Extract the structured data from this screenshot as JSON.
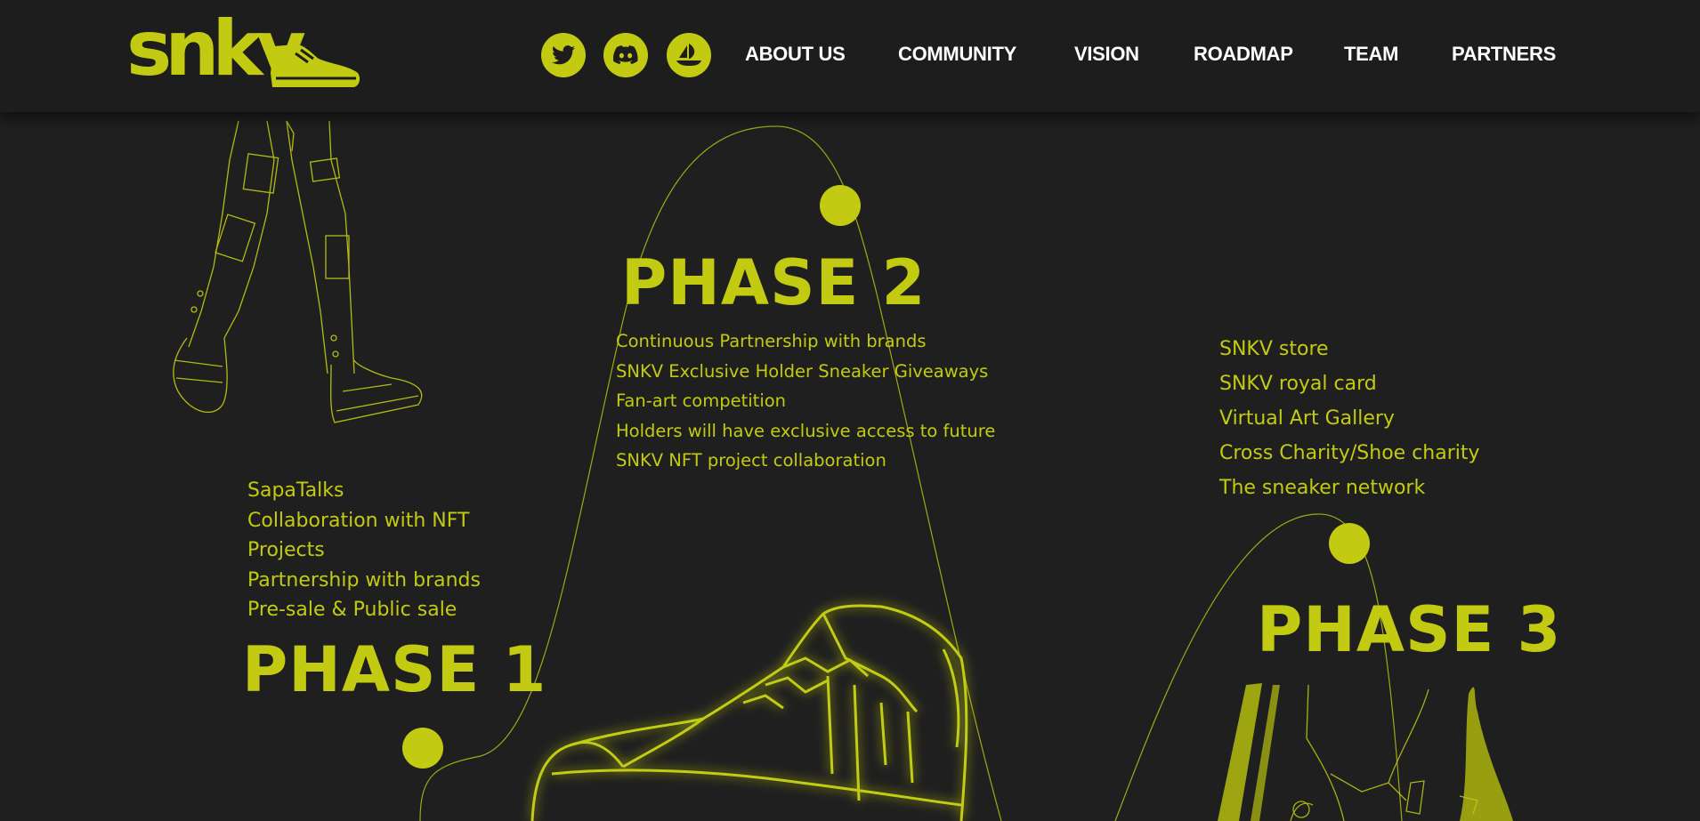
{
  "header": {
    "logo_text": "snkv",
    "social": [
      {
        "name": "twitter-icon"
      },
      {
        "name": "discord-icon"
      },
      {
        "name": "opensea-icon"
      }
    ],
    "nav": [
      {
        "label": "ABOUT US"
      },
      {
        "label": "COMMUNITY"
      },
      {
        "label": "VISION"
      },
      {
        "label": "ROADMAP"
      },
      {
        "label": "TEAM"
      },
      {
        "label": "PARTNERS"
      }
    ]
  },
  "roadmap": {
    "phase1": {
      "title": "PHASE 1",
      "items": [
        "SapaTalks",
        "Collaboration with NFT",
        "Projects",
        "Partnership with brands",
        "Pre-sale & Public sale"
      ]
    },
    "phase2": {
      "title": "PHASE 2",
      "items": [
        "Continuous Partnership with brands",
        "SNKV Exclusive Holder Sneaker Giveaways",
        "Fan-art competition",
        "Holders will have exclusive access to future",
        "SNKV NFT project collaboration"
      ]
    },
    "phase3": {
      "title": "PHASE 3",
      "items": [
        "SNKV store",
        "SNKV royal card",
        "Virtual Art Gallery",
        "Cross Charity/Shoe charity",
        "The sneaker network"
      ]
    }
  },
  "colors": {
    "accent": "#c2cb12",
    "background": "#1f1f1f",
    "header": "#1d1d1d",
    "nav_text": "#ffffff"
  }
}
